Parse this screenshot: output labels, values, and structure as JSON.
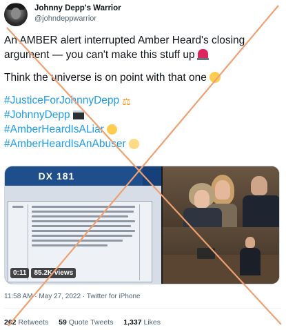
{
  "author": {
    "display_name": "Johnny Depp's Warrior",
    "handle": "@johndeppwarrior"
  },
  "tweet": {
    "line1": "An AMBER alert interrupted Amber Heard's closing",
    "line2": "argument — you can't make this stuff up",
    "line3": "Think the universe is on point with that one",
    "hashtags": [
      "#JusticeForJohnnyDepp",
      "#JohnnyDepp",
      "#AmberHeardIsALiar",
      "#AmberHeardIsAnAbuser"
    ],
    "icons": [
      "police-siren-icon",
      "tears-of-joy-icon",
      "scales-icon",
      "clapper-board-icon",
      "angry-face-icon",
      "grimace-face-icon"
    ]
  },
  "media": {
    "doc_title": "DX 181",
    "duration": "0:11",
    "views": "85.2K views"
  },
  "meta": {
    "time": "11:58 AM",
    "dot": "·",
    "date": "May 27, 2022",
    "source": "Twitter for iPhone"
  },
  "stats": {
    "retweets_count": "262",
    "retweets_label": "Retweets",
    "quotes_count": "59",
    "quotes_label": "Quote Tweets",
    "likes_count": "1,337",
    "likes_label": "Likes"
  },
  "colors": {
    "link": "#1d9bf0",
    "cross": "#f0a070",
    "muted": "#536471"
  }
}
